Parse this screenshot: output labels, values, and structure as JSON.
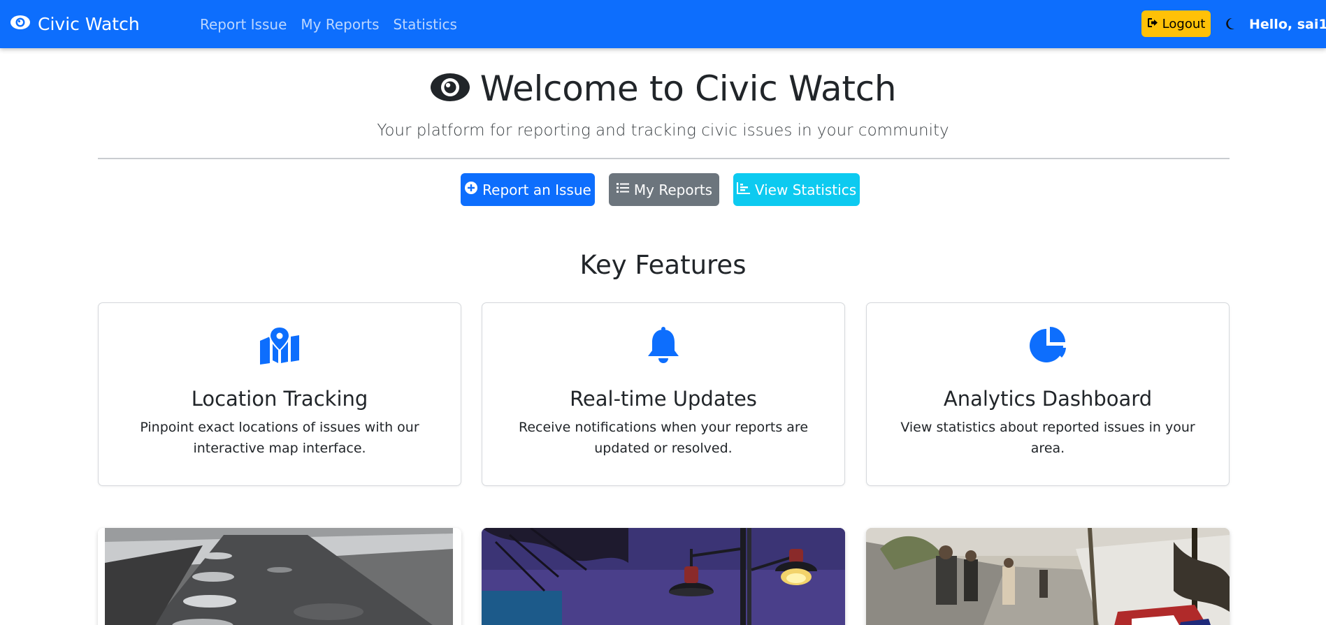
{
  "navbar": {
    "brand": "Civic Watch",
    "links": [
      {
        "label": "Report Issue"
      },
      {
        "label": "My Reports"
      },
      {
        "label": "Statistics"
      }
    ],
    "logout_label": "Logout",
    "greeting": "Hello, sai1",
    "bg_color": "#0d6efd",
    "logout_color": "#ffc107"
  },
  "hero": {
    "title": "Welcome to Civic Watch",
    "subtitle": "Your platform for reporting and tracking civic issues in your community"
  },
  "actions": {
    "report": "Report an Issue",
    "my_reports": "My Reports",
    "stats": "View Statistics"
  },
  "features": {
    "heading": "Key Features",
    "items": [
      {
        "icon": "map-location-icon",
        "title": "Location Tracking",
        "text": "Pinpoint exact locations of issues with our interactive map interface."
      },
      {
        "icon": "bell-icon",
        "title": "Real-time Updates",
        "text": "Receive notifications when your reports are updated or resolved."
      },
      {
        "icon": "pie-chart-icon",
        "title": "Analytics Dashboard",
        "text": "View statistics about reported issues in your area."
      }
    ]
  },
  "gallery": {
    "images": [
      {
        "subject": "road with potholes"
      },
      {
        "subject": "street lamps at dusk"
      },
      {
        "subject": "street with garbage"
      }
    ]
  },
  "colors": {
    "primary": "#0d6efd",
    "secondary": "#6c757d",
    "info": "#0dcaf0",
    "warning": "#ffc107"
  }
}
